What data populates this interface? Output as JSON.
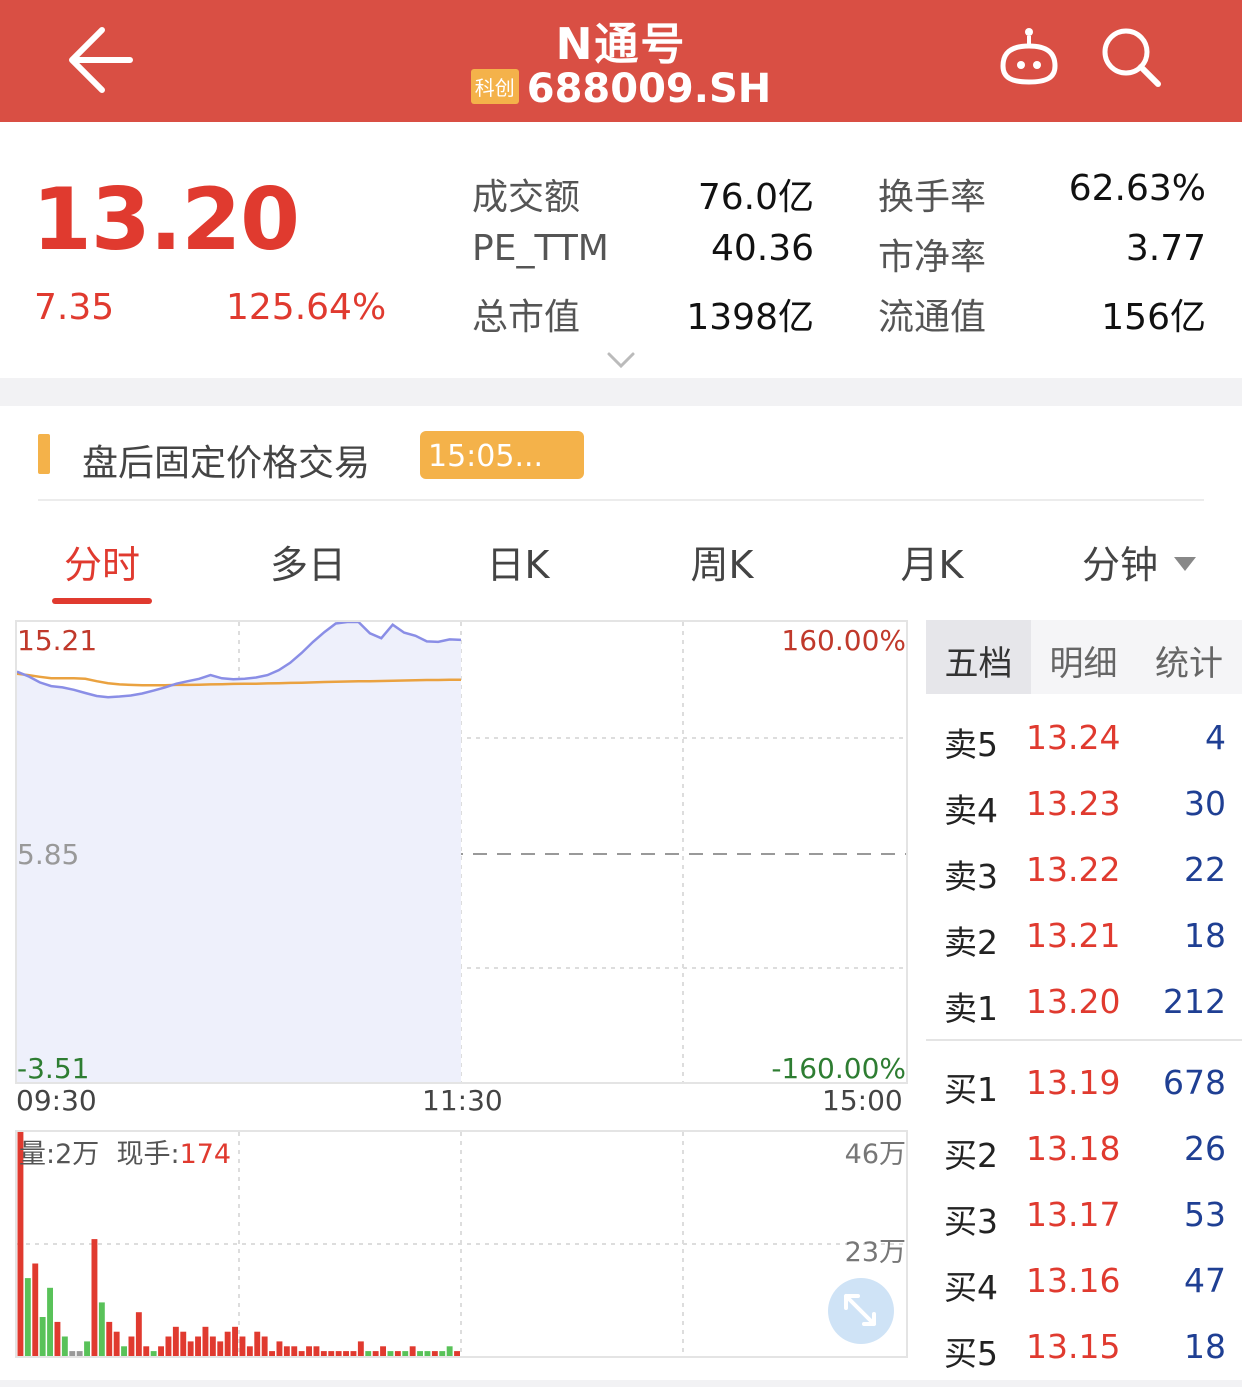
{
  "header": {
    "title": "N通号",
    "badge": "科创",
    "code": "688009.SH"
  },
  "quote": {
    "price": "13.20",
    "change": "7.35",
    "change_pct": "125.64%",
    "stats": [
      {
        "label": "成交额",
        "value": "76.0亿"
      },
      {
        "label": "换手率",
        "value": "62.63%"
      },
      {
        "label": "PE_TTM",
        "value": "40.36"
      },
      {
        "label": "市净率",
        "value": "3.77"
      },
      {
        "label": "总市值",
        "value": "1398亿"
      },
      {
        "label": "流通值",
        "value": "156亿"
      }
    ]
  },
  "after_hours": {
    "label": "盘后固定价格交易",
    "time": "15:05..."
  },
  "tabs": [
    "分时",
    "多日",
    "日K",
    "周K",
    "月K",
    "分钟"
  ],
  "active_tab": "分时",
  "chart": {
    "y_top": "15.21",
    "y_mid": "5.85",
    "y_bottom": "-3.51",
    "pct_top": "160.00%",
    "pct_bottom": "-160.00%",
    "time_start": "09:30",
    "time_mid": "11:30",
    "time_end": "15:00",
    "vol_label": "量:2万",
    "cur_hand_label": "现手:",
    "cur_hand_value": "174",
    "vol_top": "46万",
    "vol_mid": "23万"
  },
  "chart_data": {
    "type": "line",
    "title": "",
    "xlabel": "",
    "ylabel": "",
    "x_ticks": [
      "09:30",
      "11:30",
      "15:00"
    ],
    "ylim": [
      -3.51,
      15.21
    ],
    "pct_range": [
      "-160.00%",
      "160.00%"
    ],
    "prev_close": 5.85,
    "series": [
      {
        "values": [
          13.19,
          13.0,
          12.75,
          12.6,
          12.55,
          12.45,
          12.32,
          12.2,
          12.15,
          12.18,
          12.22,
          12.3,
          12.42,
          12.55,
          12.7,
          12.8,
          12.9,
          13.05,
          12.92,
          12.88,
          12.9,
          12.95,
          13.05,
          13.25,
          13.55,
          13.95,
          14.4,
          14.8,
          15.15,
          15.21,
          15.21,
          14.75,
          14.55,
          15.1,
          14.78,
          14.65,
          14.42,
          14.4,
          14.5,
          14.48
        ]
      },
      {
        "values": [
          13.1,
          13.05,
          12.98,
          12.92,
          12.92,
          12.92,
          12.9,
          12.8,
          12.72,
          12.67,
          12.65,
          12.64,
          12.64,
          12.64,
          12.65,
          12.65,
          12.66,
          12.67,
          12.68,
          12.69,
          12.7,
          12.7,
          12.71,
          12.72,
          12.73,
          12.74,
          12.75,
          12.77,
          12.78,
          12.79,
          12.8,
          12.8,
          12.81,
          12.82,
          12.83,
          12.84,
          12.85,
          12.85,
          12.86,
          12.86
        ]
      }
    ],
    "volume": {
      "ylim": [
        0,
        46
      ],
      "unit": "万",
      "values": [
        46,
        16,
        19,
        8,
        14,
        7,
        4,
        1,
        1,
        3,
        24,
        11,
        7,
        5,
        2,
        4,
        9,
        2,
        1,
        2,
        4,
        6,
        5,
        3,
        4,
        6,
        4,
        3,
        5,
        6,
        4,
        2,
        5,
        4,
        1,
        3,
        2,
        2,
        1,
        2,
        2,
        1,
        1,
        1,
        1,
        1,
        3,
        1,
        1,
        2,
        1,
        1,
        1,
        2,
        1,
        1,
        1,
        1,
        2,
        1
      ],
      "colors": [
        "r",
        "g",
        "r",
        "g",
        "g",
        "r",
        "g",
        "n",
        "n",
        "g",
        "r",
        "g",
        "r",
        "r",
        "g",
        "r",
        "r",
        "r",
        "g",
        "r",
        "r",
        "r",
        "r",
        "r",
        "r",
        "r",
        "r",
        "r",
        "r",
        "r",
        "r",
        "r",
        "r",
        "r",
        "r",
        "r",
        "r",
        "r",
        "r",
        "r",
        "r",
        "r",
        "r",
        "r",
        "r",
        "r",
        "r",
        "g",
        "r",
        "r",
        "g",
        "r",
        "g",
        "r",
        "g",
        "g",
        "r",
        "g",
        "g",
        "r"
      ]
    }
  },
  "order_book": {
    "tabs": [
      "五档",
      "明细",
      "统计"
    ],
    "asks": [
      {
        "label": "卖5",
        "price": "13.24",
        "vol": "4"
      },
      {
        "label": "卖4",
        "price": "13.23",
        "vol": "30"
      },
      {
        "label": "卖3",
        "price": "13.22",
        "vol": "22"
      },
      {
        "label": "卖2",
        "price": "13.21",
        "vol": "18"
      },
      {
        "label": "卖1",
        "price": "13.20",
        "vol": "212"
      }
    ],
    "bids": [
      {
        "label": "买1",
        "price": "13.19",
        "vol": "678"
      },
      {
        "label": "买2",
        "price": "13.18",
        "vol": "26"
      },
      {
        "label": "买3",
        "price": "13.17",
        "vol": "53"
      },
      {
        "label": "买4",
        "price": "13.16",
        "vol": "47"
      },
      {
        "label": "买5",
        "price": "13.15",
        "vol": "18"
      }
    ]
  },
  "colors": {
    "brand_red": "#d94f44",
    "up_red": "#e03a2f",
    "down_green": "#2e8b2e",
    "price_line": "#8a8ee6",
    "avg_line": "#eaa240",
    "accent_yellow": "#f4b24a"
  },
  "icons": {
    "back": "back-arrow-icon",
    "robot": "robot-icon",
    "search": "search-icon",
    "expand": "expand-icon",
    "chevron": "chevron-down-icon"
  }
}
